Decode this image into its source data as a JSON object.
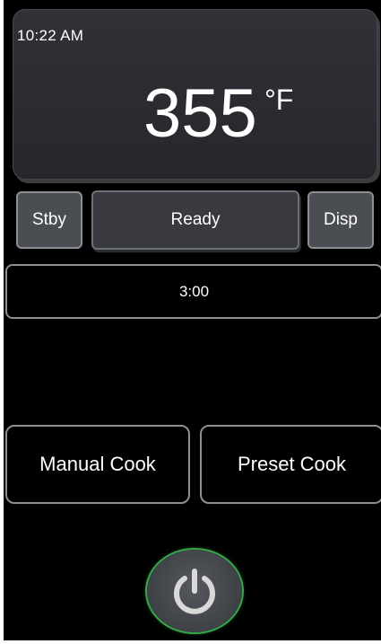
{
  "clock": {
    "time": "10:22 AM"
  },
  "temperature": {
    "value": "355",
    "unit": "°F"
  },
  "controls": {
    "standby_label": "Stby",
    "status_label": "Ready",
    "display_label": "Disp"
  },
  "timer": {
    "value": "3:00"
  },
  "cook_modes": {
    "manual_label": "Manual Cook",
    "preset_label": "Preset Cook"
  },
  "power": {
    "icon": "power-icon",
    "ring_color": "#36a84a"
  }
}
